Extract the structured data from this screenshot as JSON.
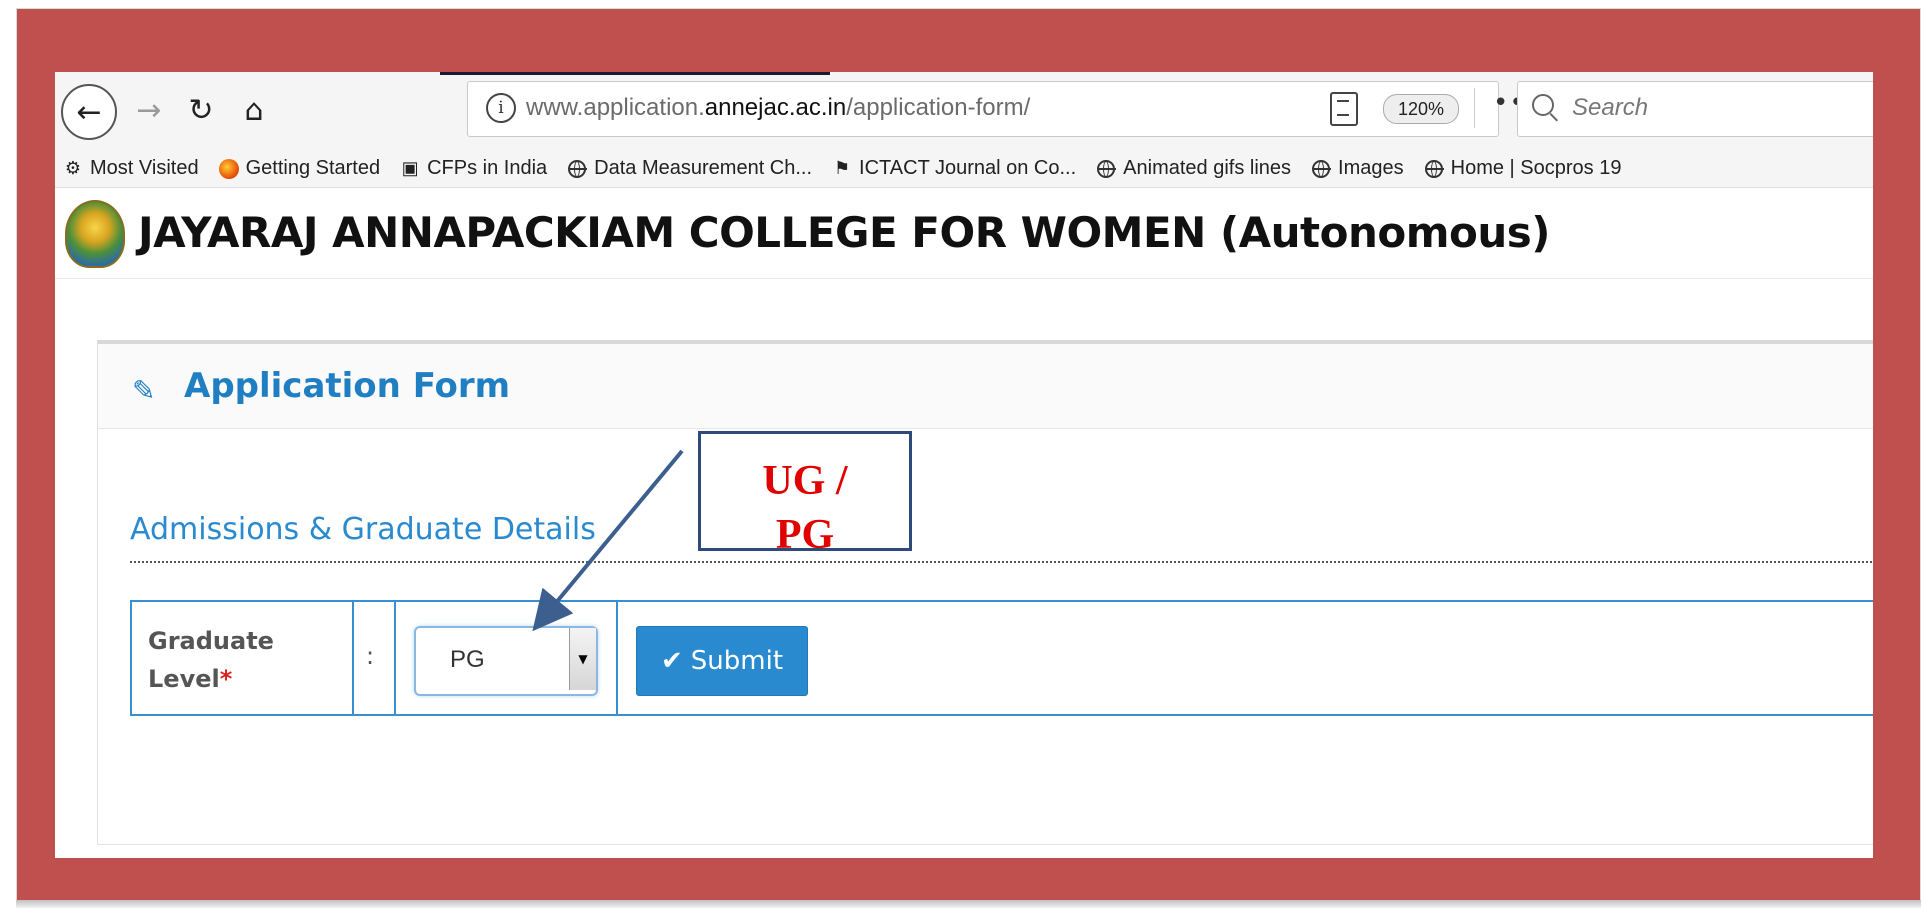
{
  "browser": {
    "url_prefix": "www.application.",
    "url_domain": "annejac.ac.in",
    "url_path": "/application-form/",
    "zoom": "120%",
    "more_label": "•••",
    "search_placeholder": "Search"
  },
  "bookmarks": [
    {
      "label": "Most Visited",
      "icon": "gear-icon"
    },
    {
      "label": "Getting Started",
      "icon": "firefox-icon"
    },
    {
      "label": "CFPs in India",
      "icon": "chair-icon"
    },
    {
      "label": "Data Measurement Ch...",
      "icon": "globe-icon"
    },
    {
      "label": "ICTACT Journal on Co...",
      "icon": "journal-icon"
    },
    {
      "label": "Animated gifs lines",
      "icon": "globe-icon"
    },
    {
      "label": "Images",
      "icon": "globe-icon"
    },
    {
      "label": "Home | Socpros 19",
      "icon": "globe-icon"
    }
  ],
  "page": {
    "college_name": "JAYARAJ ANNAPACKIAM COLLEGE FOR WOMEN (Autonomous)",
    "form_title": "Application Form",
    "section_title": "Admissions & Graduate Details",
    "field_label_line1": "Graduate",
    "field_label_line2": "Level",
    "required_mark": "*",
    "colon": ":",
    "selected_value": "PG",
    "submit_label": "Submit"
  },
  "annotation": {
    "line1": "UG /",
    "line2": "PG"
  },
  "colors": {
    "frame": "#c0504d",
    "accent": "#2a8ad0",
    "annotation_text": "#e00000",
    "arrow": "#3d5f8f"
  }
}
